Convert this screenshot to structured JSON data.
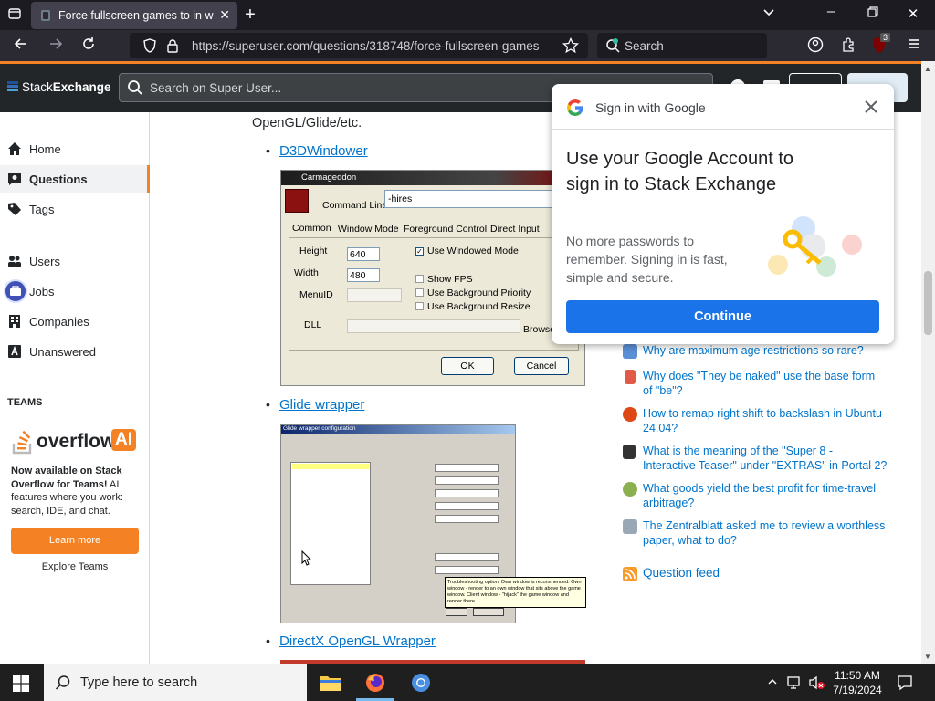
{
  "browser": {
    "tab_title": "Force fullscreen games to in window",
    "url": "https://superuser.com/questions/318748/force-fullscreen-games",
    "search_placeholder": "Search",
    "ext_badge": "3"
  },
  "se": {
    "logo_a": "Stack",
    "logo_b": "Exchange",
    "search_placeholder": "Search on Super User..."
  },
  "leftnav": {
    "items": [
      {
        "label": "Home"
      },
      {
        "label": "Questions"
      },
      {
        "label": "Tags"
      },
      {
        "label": "Users"
      },
      {
        "label": "Jobs"
      },
      {
        "label": "Companies"
      },
      {
        "label": "Unanswered"
      }
    ],
    "teams_heading": "TEAMS",
    "overflow_brand": "overflow",
    "overflow_ai": "AI",
    "promo_bold": "Now available on Stack Overflow for Teams!",
    "promo_rest": " AI features where you work: search, IDE, and chat.",
    "learn_more": "Learn more",
    "explore": "Explore Teams"
  },
  "main": {
    "intro_text": "OpenGL/Glide/etc.",
    "links": [
      "D3DWindower",
      "Glide wrapper",
      "DirectX OpenGL Wrapper"
    ],
    "d3d_window": {
      "title": "Carmageddon",
      "command_line_label": "Command Line",
      "command_line_value": "-hires",
      "tabs": [
        "Common",
        "Window Mode",
        "Foreground Control",
        "Direct Input"
      ],
      "height_label": "Height",
      "height_value": "640",
      "width_label": "Width",
      "width_value": "480",
      "menuid_label": "MenuID",
      "dll_label": "DLL",
      "browse": "Browse",
      "checks": [
        "Use Windowed Mode",
        "Show FPS",
        "Use Background Priority",
        "Use Background Resize"
      ],
      "ok": "OK",
      "cancel": "Cancel"
    },
    "glide_window": {
      "title": "Glide wrapper configuration",
      "tooltip": "Troubleshooting option. Own window is recommended. Own window - render to an own window that sits above the game window. Client window - \"hijack\" the game window and render there"
    }
  },
  "google": {
    "header": "Sign in with Google",
    "heading": "Use your Google Account to sign in to Stack Exchange",
    "desc": "No more passwords to remember. Signing in is fast, simple and secure.",
    "continue": "Continue"
  },
  "hot": [
    {
      "text": "Why are maximum age restrictions so rare?",
      "color": "#5b8fd6"
    },
    {
      "text": "Why does \"They be naked\" use the base form of \"be\"?",
      "color": "#e05a47"
    },
    {
      "text": "How to remap right shift to backslash in Ubuntu 24.04?",
      "color": "#dd4814"
    },
    {
      "text": "What is the meaning of the \"Super 8 - Interactive Teaser\" under \"EXTRAS\" in Portal 2?",
      "color": "#333333"
    },
    {
      "text": "What goods yield the best profit for time-travel arbitrage?",
      "color": "#8bb04f"
    },
    {
      "text": "The Zentralblatt asked me to review a worthless paper, what to do?",
      "color": "#9aa7b5"
    }
  ],
  "question_feed": "Question feed",
  "taskbar": {
    "search_placeholder": "Type here to search",
    "time": "11:50 AM",
    "date": "7/19/2024"
  }
}
